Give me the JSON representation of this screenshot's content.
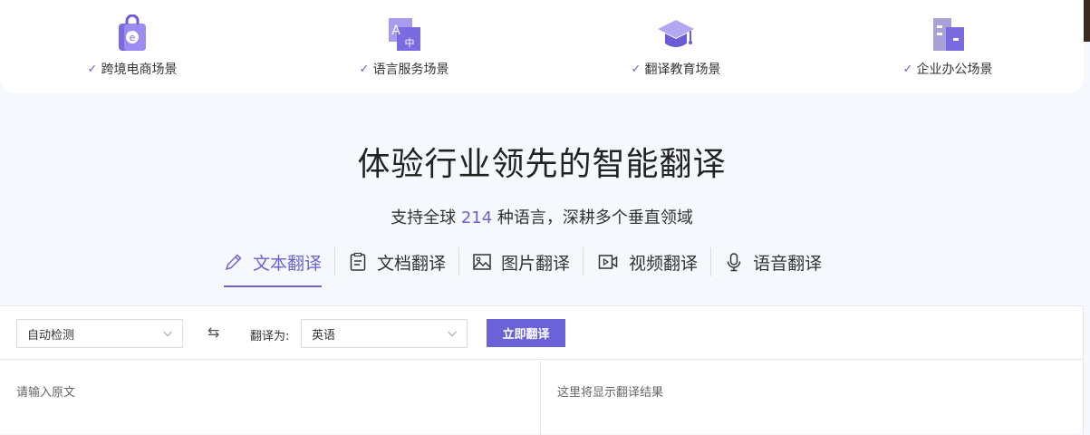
{
  "scenes": [
    {
      "label": "跨境电商场景",
      "icon": "shopping-bag-icon"
    },
    {
      "label": "语言服务场景",
      "icon": "translate-letters-icon"
    },
    {
      "label": "翻译教育场景",
      "icon": "graduation-cap-icon"
    },
    {
      "label": "企业办公场景",
      "icon": "office-building-icon"
    }
  ],
  "check_mark": "✓",
  "hero": {
    "title": "体验行业领先的智能翻译",
    "subtitle_prefix": "支持全球 ",
    "language_count": "214",
    "subtitle_suffix": " 种语言，深耕多个垂直领域"
  },
  "tabs": [
    {
      "label": "文本翻译",
      "icon": "pencil-icon",
      "active": true
    },
    {
      "label": "文档翻译",
      "icon": "document-icon",
      "active": false
    },
    {
      "label": "图片翻译",
      "icon": "image-icon",
      "active": false
    },
    {
      "label": "视频翻译",
      "icon": "video-icon",
      "active": false
    },
    {
      "label": "语音翻译",
      "icon": "microphone-icon",
      "active": false
    }
  ],
  "translator": {
    "source_language": "自动检测",
    "swap_symbol": "⇆",
    "target_label": "翻译为:",
    "target_language": "英语",
    "translate_button": "立即翻译",
    "source_placeholder": "请输入原文",
    "result_placeholder": "这里将显示翻译结果"
  },
  "colors": {
    "accent": "#6a62d6",
    "background": "#f5f8fd",
    "card": "#ffffff"
  }
}
